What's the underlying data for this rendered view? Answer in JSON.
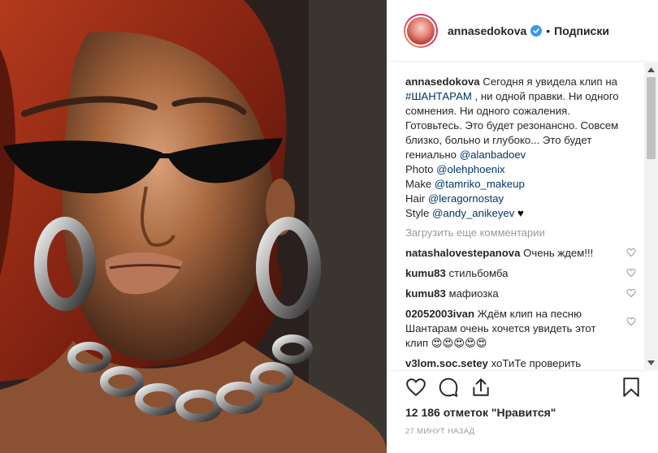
{
  "header": {
    "username": "annasedokova",
    "separator": "•",
    "follow_label": "Подписки"
  },
  "caption": {
    "username": "annasedokova",
    "t1": " Сегодня я увидела клип на ",
    "hashtag": "#ШАНТАРАМ",
    "t2": " , ни одной правки. Ни одного сомнения. Ни одного сожаления. Готовьтесь. Это будет резонансно. Совсем близко, больно и глубоко... Это будет гениально ",
    "mention1": "@alanbadoev",
    "photo_label": "Photo ",
    "mention2": "@olehphoenix",
    "make_label": "Make ",
    "mention3": "@tamriko_makeup",
    "hair_label": "Hair ",
    "mention4": "@leragornostay",
    "style_label": "Style ",
    "mention5": "@andy_anikeyev",
    "heart": " ♥"
  },
  "load_more": "Загрузить еще комментарии",
  "comments": [
    {
      "user": "natashalovestepanova",
      "text": " Очень ждем!!!"
    },
    {
      "user": "kumu83",
      "text": " стильбомба"
    },
    {
      "user": "kumu83",
      "text": " мафиозка"
    },
    {
      "user": "02052003ivan",
      "text": " Ждём клип на песню Шантарам очень хочется увидеть этот клип 😍😍😍😍😍"
    },
    {
      "user": "v3lom.soc.setey",
      "text": " хоТиТе проверить"
    }
  ],
  "likes_text": "12 186 отметок \"Нравится\"",
  "timestamp": "27 минут назад",
  "icons": [
    "verified-badge-icon",
    "heart-outline-icon",
    "comment-icon",
    "share-icon",
    "bookmark-icon",
    "scroll-up-icon",
    "scroll-down-icon"
  ]
}
